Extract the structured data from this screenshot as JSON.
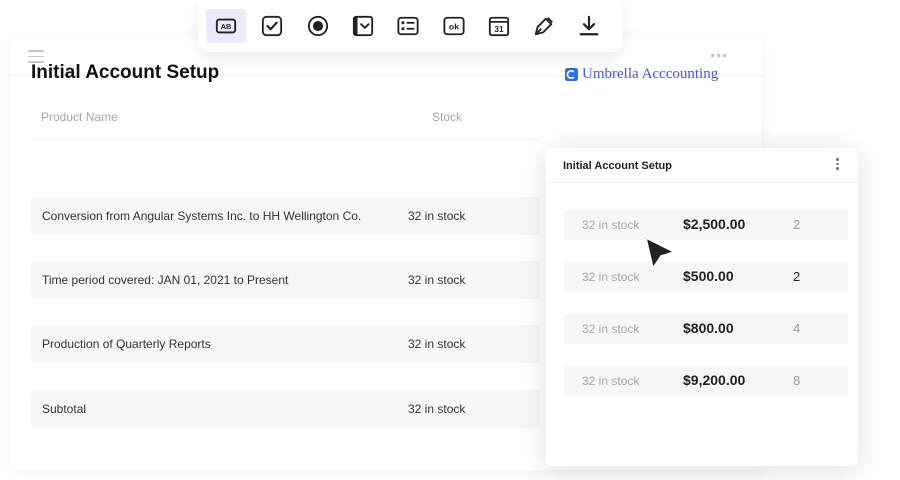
{
  "document": {
    "title": "Initial Account Setup",
    "brand": "Umbrella Acccounting",
    "columns": {
      "product": "Product Name",
      "stock": "Stock"
    },
    "rows": [
      {
        "name": "Conversion from Angular Systems Inc. to HH Wellington Co.",
        "stock": "32 in stock"
      },
      {
        "name": "Time period covered: JAN 01, 2021 to Present",
        "stock": "32 in stock"
      },
      {
        "name": "Production of Quarterly Reports",
        "stock": "32 in stock"
      },
      {
        "name": "Subtotal",
        "stock": "32 in stock"
      }
    ]
  },
  "toolbar": {
    "tools": [
      {
        "icon": "text-field-icon",
        "label": "AB",
        "active": true
      },
      {
        "icon": "checkbox-icon"
      },
      {
        "icon": "radio-button-icon"
      },
      {
        "icon": "dropdown-icon"
      },
      {
        "icon": "list-icon"
      },
      {
        "icon": "ok-button-icon",
        "label": "ok"
      },
      {
        "icon": "calendar-icon",
        "label": "31"
      },
      {
        "icon": "signature-pen-icon"
      },
      {
        "icon": "download-icon"
      }
    ]
  },
  "card": {
    "title": "Initial Account Setup",
    "rows": [
      {
        "stock": "32 in stock",
        "price": "$2,500.00",
        "qty": "2"
      },
      {
        "stock": "32 in stock",
        "price": "$500.00",
        "qty": "2"
      },
      {
        "stock": "32 in stock",
        "price": "$800.00",
        "qty": "4"
      },
      {
        "stock": "32 in stock",
        "price": "$9,200.00",
        "qty": "8"
      }
    ]
  },
  "colors": {
    "accent": "#4b56c8",
    "active_tool_bg": "#ece9fb",
    "row_bg": "#f7f7f7"
  }
}
